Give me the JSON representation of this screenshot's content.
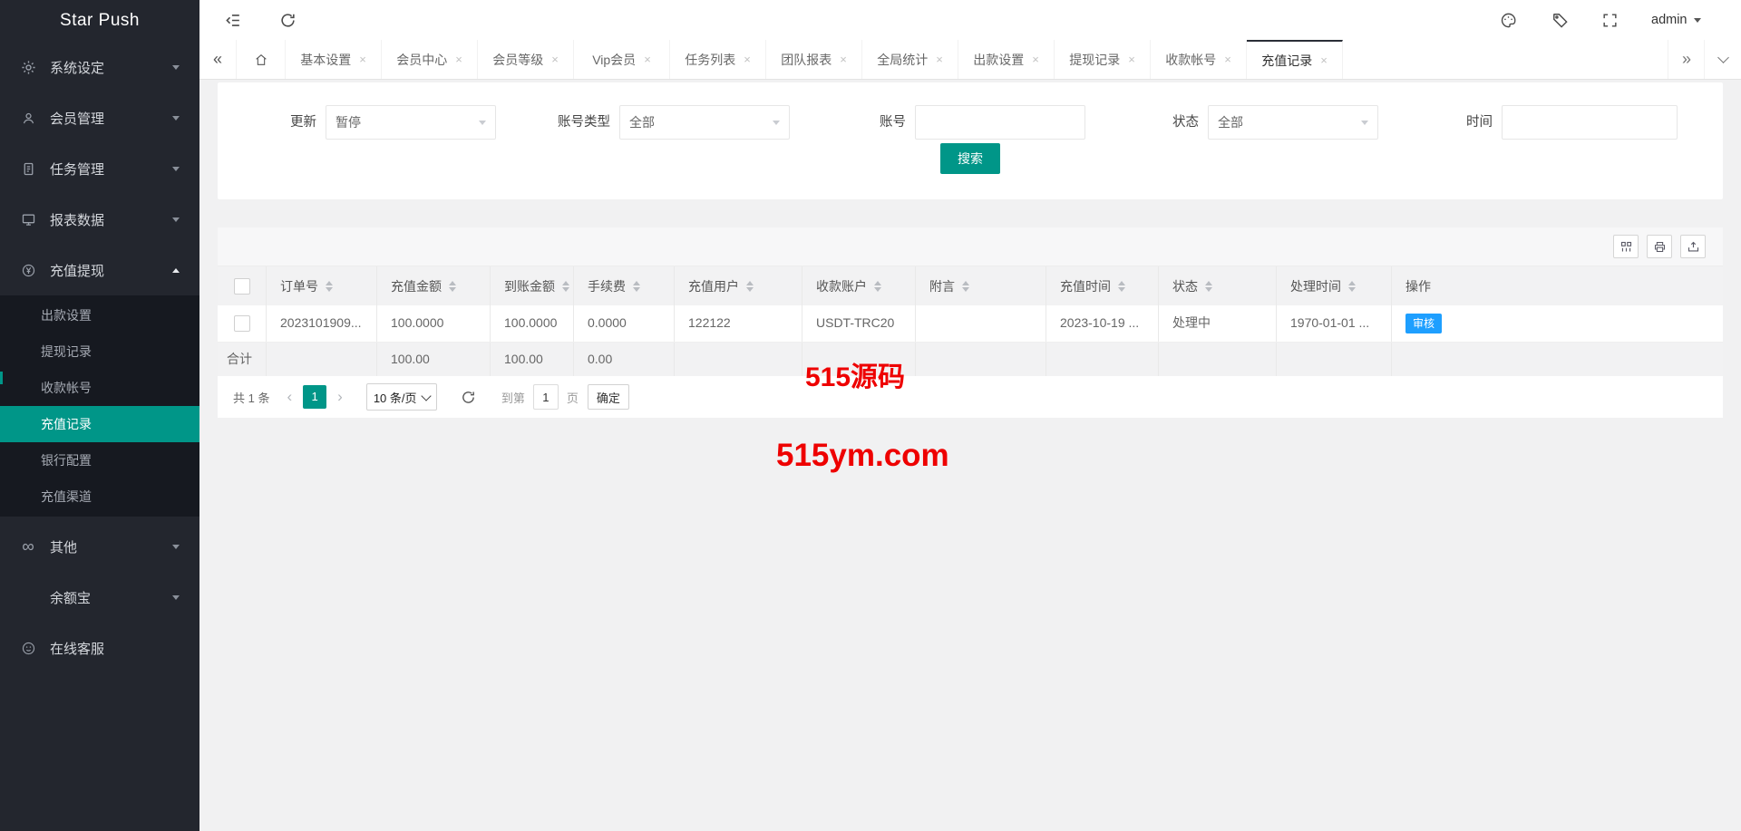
{
  "app": {
    "title": "Star Push"
  },
  "topbar": {
    "user_label": "admin",
    "icons_left": [
      "menu-fold-icon",
      "refresh-icon"
    ],
    "icons_right": [
      "palette-icon",
      "tag-icon",
      "fullscreen-icon",
      "caret-down-icon"
    ]
  },
  "sidebar": {
    "title": "Star Push",
    "items": [
      {
        "label": "系统设定",
        "icon": "gear-icon"
      },
      {
        "label": "会员管理",
        "icon": "user-icon"
      },
      {
        "label": "任务管理",
        "icon": "tasks-icon"
      },
      {
        "label": "报表数据",
        "icon": "report-icon"
      },
      {
        "label": "充值提现",
        "icon": "yen-icon",
        "expanded": true
      }
    ],
    "submenu": [
      {
        "label": "出款设置"
      },
      {
        "label": "提现记录"
      },
      {
        "label": "收款帐号"
      },
      {
        "label": "充值记录",
        "active": true
      },
      {
        "label": "银行配置"
      },
      {
        "label": "充值渠道"
      }
    ],
    "items_bottom": [
      {
        "label": "其他",
        "icon": "infinity-icon"
      },
      {
        "label": "余额宝",
        "icon": null
      },
      {
        "label": "在线客服",
        "icon": "service-icon"
      }
    ]
  },
  "tabbar": {
    "tabs": [
      {
        "label": "基本设置"
      },
      {
        "label": "会员中心"
      },
      {
        "label": "会员等级"
      },
      {
        "label": "Vip会员"
      },
      {
        "label": "任务列表"
      },
      {
        "label": "团队报表"
      },
      {
        "label": "全局统计"
      },
      {
        "label": "出款设置"
      },
      {
        "label": "提现记录"
      },
      {
        "label": "收款帐号"
      },
      {
        "label": "充值记录",
        "active": true
      }
    ]
  },
  "filters": {
    "update": {
      "label": "更新",
      "value": "暂停"
    },
    "account_type": {
      "label": "账号类型",
      "value": "全部"
    },
    "account": {
      "label": "账号",
      "value": ""
    },
    "status": {
      "label": "状态",
      "value": "全部"
    },
    "time": {
      "label": "时间",
      "value": ""
    },
    "search_label": "搜索"
  },
  "table": {
    "headers": [
      "订单号",
      "充值金额",
      "到账金额",
      "手续费",
      "充值用户",
      "收款账户",
      "附言",
      "充值时间",
      "状态",
      "处理时间",
      "操作"
    ],
    "row": {
      "order_no": "2023101909...",
      "recharge_amount": "100.0000",
      "arrival_amount": "100.0000",
      "fee": "0.0000",
      "recharge_user": "122122",
      "receive_account": "USDT-TRC20",
      "memo": "",
      "recharge_time": "2023-10-19 ...",
      "status": "处理中",
      "process_time": "1970-01-01 ...",
      "action_label": "审核"
    },
    "total": {
      "label": "合计",
      "recharge_total": "100.00",
      "arrival_total": "100.00",
      "fee_total": "0.00"
    },
    "toolbar_icons": [
      "columns-icon",
      "print-icon",
      "export-icon"
    ]
  },
  "pagination": {
    "total_text": "共 1 条",
    "page": "1",
    "page_size": "10 条/页",
    "goto_label": "到第",
    "page_input": "1",
    "page_unit": "页",
    "confirm_label": "确定"
  },
  "watermark": {
    "line1": "515源码",
    "line2": "515ym.com"
  },
  "colors": {
    "accent_teal": "#009688",
    "action_blue": "#1e9fff",
    "watermark_red": "#ee0000",
    "sidebar_bg": "#23262e",
    "submenu_bg": "#161920"
  }
}
